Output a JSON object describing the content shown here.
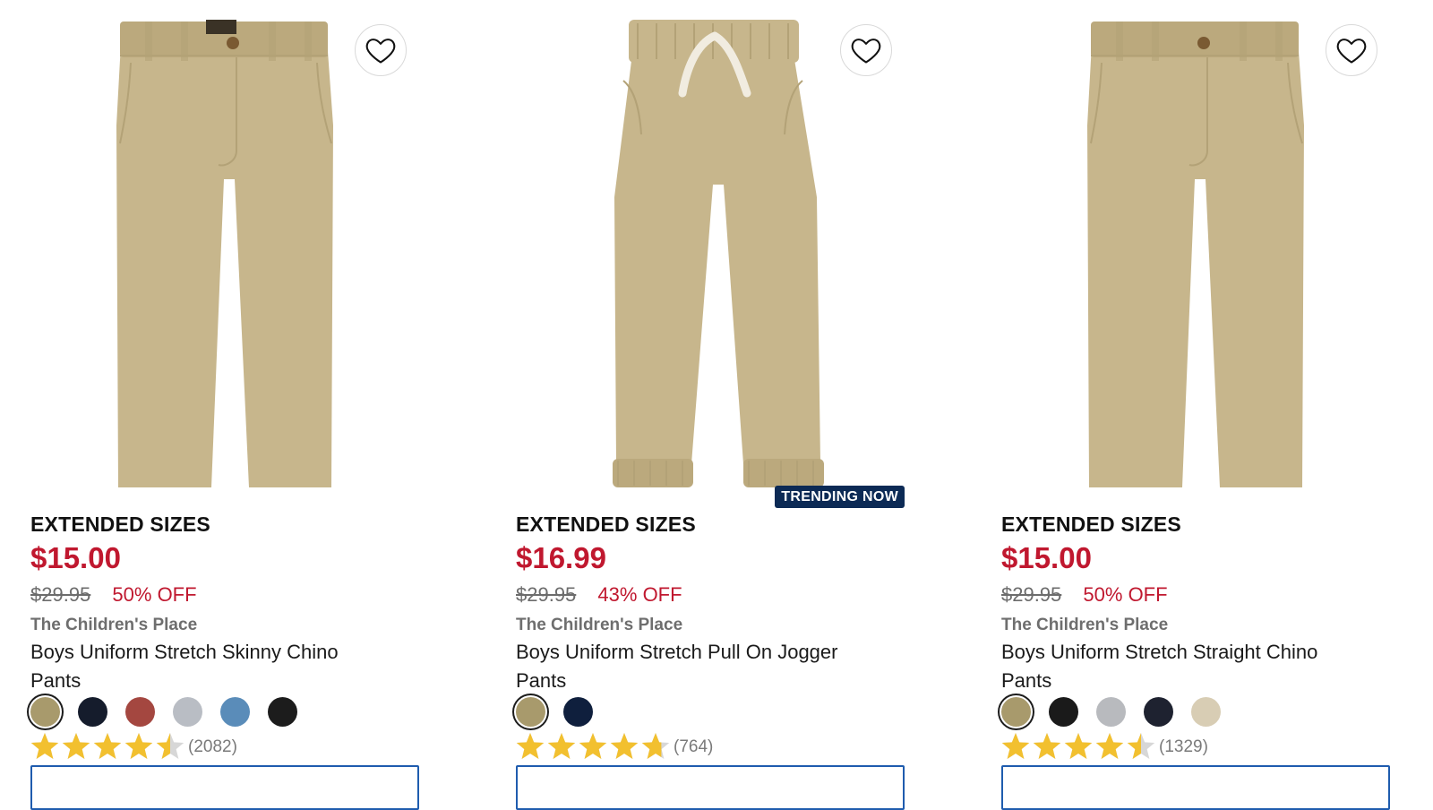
{
  "products": [
    {
      "eyebrow": "EXTENDED SIZES",
      "price": "$15.00",
      "was_price": "$29.95",
      "discount": "50% OFF",
      "brand": "The Children's Place",
      "title": "Boys Uniform Stretch Skinny Chino Pants",
      "badge": "",
      "rating": 4.5,
      "review_count": "(2082)",
      "swatches": [
        "#a89a6c",
        "#151c2c",
        "#a44740",
        "#b9bdc4",
        "#5a8cb9",
        "#1c1c1c"
      ],
      "selected_swatch": 0,
      "style": "chino-fly",
      "icons": {
        "wishlist": "heart-outline-icon"
      }
    },
    {
      "eyebrow": "EXTENDED SIZES",
      "price": "$16.99",
      "was_price": "$29.95",
      "discount": "43% OFF",
      "brand": "The Children's Place",
      "title": "Boys Uniform Stretch Pull On Jogger Pants",
      "badge": "TRENDING NOW",
      "rating": 4.7,
      "review_count": "(764)",
      "swatches": [
        "#a89a6c",
        "#0f1f3d"
      ],
      "selected_swatch": 0,
      "style": "jogger",
      "icons": {
        "wishlist": "heart-outline-icon"
      }
    },
    {
      "eyebrow": "EXTENDED SIZES",
      "price": "$15.00",
      "was_price": "$29.95",
      "discount": "50% OFF",
      "brand": "The Children's Place",
      "title": "Boys Uniform Stretch Straight Chino Pants",
      "badge": "",
      "rating": 4.5,
      "review_count": "(1329)",
      "swatches": [
        "#a89a6c",
        "#1a1a1a",
        "#b8babe",
        "#1e2230",
        "#d8cdb4"
      ],
      "selected_swatch": 0,
      "style": "chino-straight",
      "icons": {
        "wishlist": "heart-outline-icon"
      }
    }
  ],
  "colors": {
    "price_red": "#c0182f",
    "badge_navy": "#0c2a55",
    "star_gold": "#f2c02f",
    "star_empty": "#d7d7d7",
    "cta_border": "#1f5cae",
    "khaki": "#c7b68c"
  }
}
